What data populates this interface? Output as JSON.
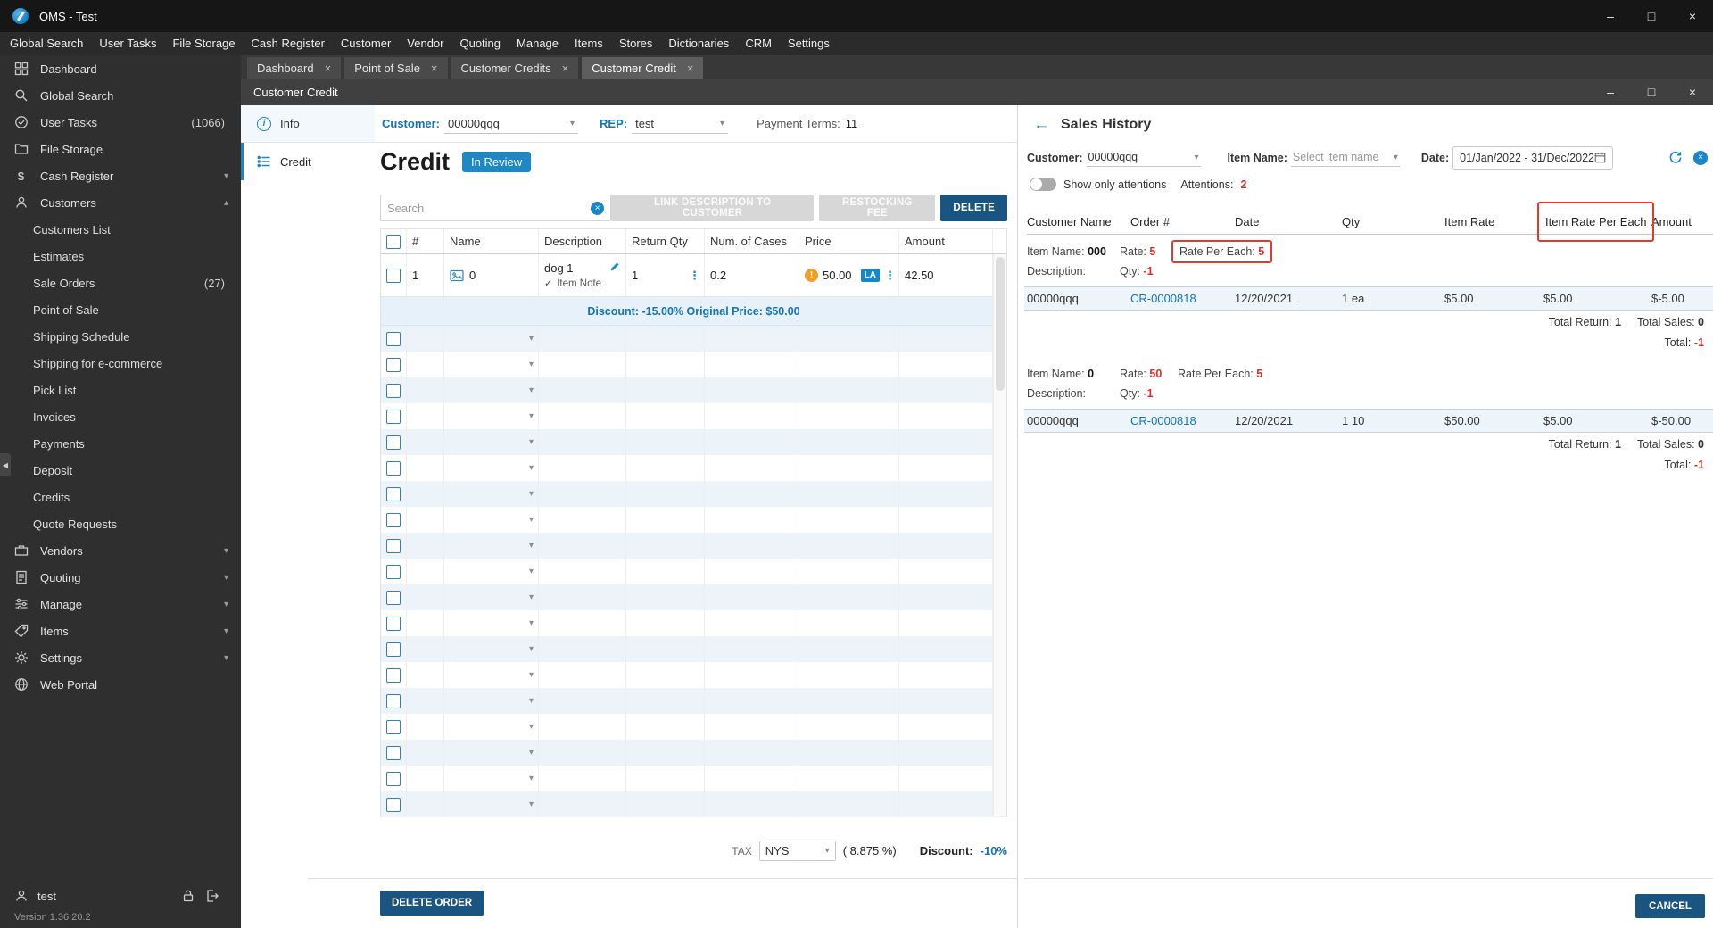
{
  "titlebar": {
    "title": "OMS - Test"
  },
  "menubar": {
    "items": [
      "Global Search",
      "User Tasks",
      "File Storage",
      "Cash Register",
      "Customer",
      "Vendor",
      "Quoting",
      "Manage",
      "Items",
      "Stores",
      "Dictionaries",
      "CRM",
      "Settings"
    ]
  },
  "sidebar": {
    "items": [
      {
        "label": "Dashboard"
      },
      {
        "label": "Global Search"
      },
      {
        "label": "User Tasks",
        "badge": "(1066)"
      },
      {
        "label": "File Storage"
      },
      {
        "label": "Cash Register"
      },
      {
        "label": "Customers"
      },
      {
        "label": "Vendors"
      },
      {
        "label": "Quoting"
      },
      {
        "label": "Manage"
      },
      {
        "label": "Items"
      },
      {
        "label": "Settings"
      },
      {
        "label": "Web Portal"
      }
    ],
    "customers_sub": [
      {
        "label": "Customers List"
      },
      {
        "label": "Estimates"
      },
      {
        "label": "Sale Orders",
        "badge": "(27)"
      },
      {
        "label": "Point of Sale"
      },
      {
        "label": "Shipping Schedule"
      },
      {
        "label": "Shipping for e-commerce"
      },
      {
        "label": "Pick List"
      },
      {
        "label": "Invoices"
      },
      {
        "label": "Payments"
      },
      {
        "label": "Deposit"
      },
      {
        "label": "Credits"
      },
      {
        "label": "Quote Requests"
      }
    ],
    "user": "test",
    "version": "Version 1.36.20.2"
  },
  "tabs": [
    {
      "label": "Dashboard"
    },
    {
      "label": "Point of Sale"
    },
    {
      "label": "Customer Credits"
    },
    {
      "label": "Customer Credit"
    }
  ],
  "window": {
    "title": "Customer Credit"
  },
  "credit": {
    "customer_label": "Customer:",
    "customer_value": "00000qqq",
    "rep_label": "REP:",
    "rep_value": "test",
    "terms_label": "Payment Terms:",
    "terms_value": "11",
    "nav_info": "Info",
    "nav_credit": "Credit",
    "title": "Credit",
    "status": "In Review",
    "search_placeholder": "Search",
    "btn_link": "LINK DESCRIPTION TO CUSTOMER",
    "btn_restocking": "RESTOCKING FEE",
    "btn_delete": "DELETE",
    "headers": {
      "num": "#",
      "name": "Name",
      "description": "Description",
      "return_qty": "Return Qty",
      "cases": "Num. of Cases",
      "price": "Price",
      "amount": "Amount"
    },
    "row": {
      "num": "1",
      "name": "0",
      "description": "dog 1",
      "note": "Item Note",
      "return_qty": "1",
      "cases": "0.2",
      "price": "50.00",
      "uom": "LA",
      "amount": "42.50"
    },
    "discount_note": "Discount: -15.00% Original Price: $50.00",
    "tax_label": "TAX",
    "tax_value": "NYS",
    "tax_rate": "( 8.875 %)",
    "discount_label": "Discount:",
    "discount_value": "-10%",
    "btn_delete_order": "DELETE ORDER"
  },
  "sales": {
    "title": "Sales History",
    "customer_label": "Customer:",
    "customer_value": "00000qqq",
    "item_label": "Item Name:",
    "item_placeholder": "Select item name",
    "date_label": "Date:",
    "date_value": "01/Jan/2022 - 31/Dec/2022",
    "toggle_label": "Show only attentions",
    "attentions_label": "Attentions:",
    "attentions_value": "2",
    "headers": {
      "customer": "Customer Name",
      "order": "Order #",
      "date": "Date",
      "qty": "Qty",
      "item_rate": "Item Rate",
      "rate_each": "Item Rate Per Each",
      "amount": "Amount"
    },
    "groups": [
      {
        "item_name_label": "Item Name:",
        "item_name": "000",
        "rate_label": "Rate:",
        "rate": "5",
        "rpe_label": "Rate Per Each:",
        "rpe": "5",
        "desc_label": "Description:",
        "qty_label": "Qty:",
        "qty": "-1",
        "row": {
          "customer": "00000qqq",
          "order": "CR-0000818",
          "date": "12/20/2021",
          "qty": "1 ea",
          "item_rate": "$5.00",
          "rate_each": "$5.00",
          "amount": "$-5.00"
        },
        "totals": {
          "return_label": "Total Return:",
          "return_value": "1",
          "sales_label": "Total Sales:",
          "sales_value": "0",
          "total_label": "Total:",
          "total_value": "-1"
        }
      },
      {
        "item_name_label": "Item Name:",
        "item_name": "0",
        "rate_label": "Rate:",
        "rate": "50",
        "rpe_label": "Rate Per Each:",
        "rpe": "5",
        "desc_label": "Description:",
        "qty_label": "Qty:",
        "qty": "-1",
        "row": {
          "customer": "00000qqq",
          "order": "CR-0000818",
          "date": "12/20/2021",
          "qty": "1 10",
          "item_rate": "$50.00",
          "rate_each": "$5.00",
          "amount": "$-50.00"
        },
        "totals": {
          "return_label": "Total Return:",
          "return_value": "1",
          "sales_label": "Total Sales:",
          "sales_value": "0",
          "total_label": "Total:",
          "total_value": "-1"
        }
      }
    ],
    "cancel": "CANCEL"
  },
  "colors": {
    "accent": "#1787c9",
    "link": "#1374b5",
    "primary_button": "#1a5480",
    "alert_red": "#d93025",
    "highlight_box": "#e23b2e",
    "warning": "#f29d25",
    "row_alt": "#ecf4fa"
  }
}
